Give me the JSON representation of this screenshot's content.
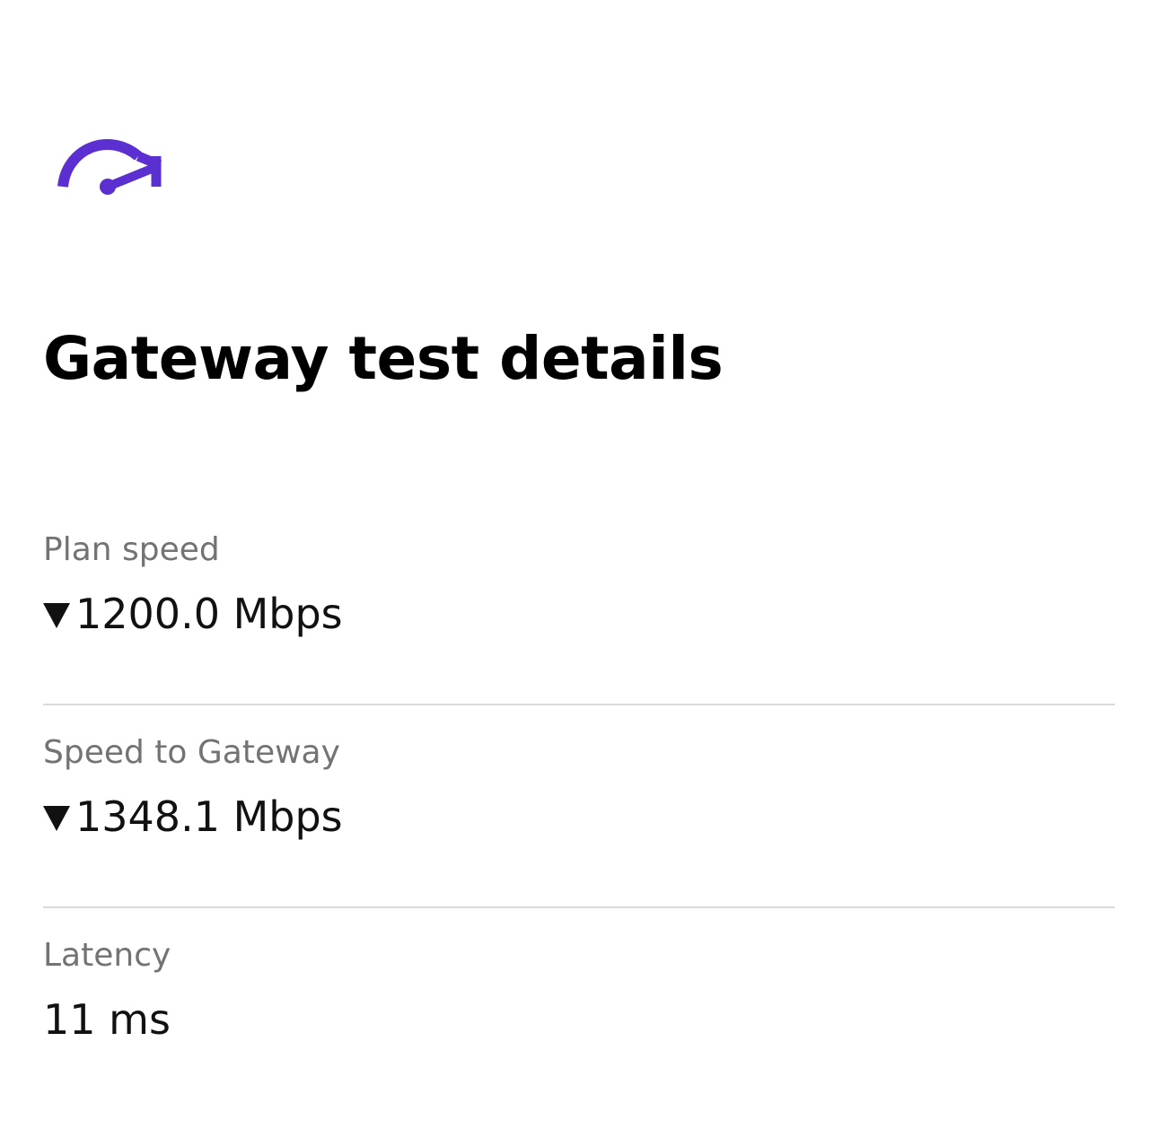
{
  "header": {
    "icon": "speedometer-icon",
    "accent_color": "#5b2fd0",
    "title": "Gateway test details"
  },
  "metrics": [
    {
      "label": "Plan speed",
      "icon": "down-arrow-icon",
      "value": "1200.0 Mbps"
    },
    {
      "label": "Speed to Gateway",
      "icon": "down-arrow-icon",
      "value": "1348.1 Mbps"
    },
    {
      "label": "Latency",
      "value": "11 ms"
    }
  ]
}
